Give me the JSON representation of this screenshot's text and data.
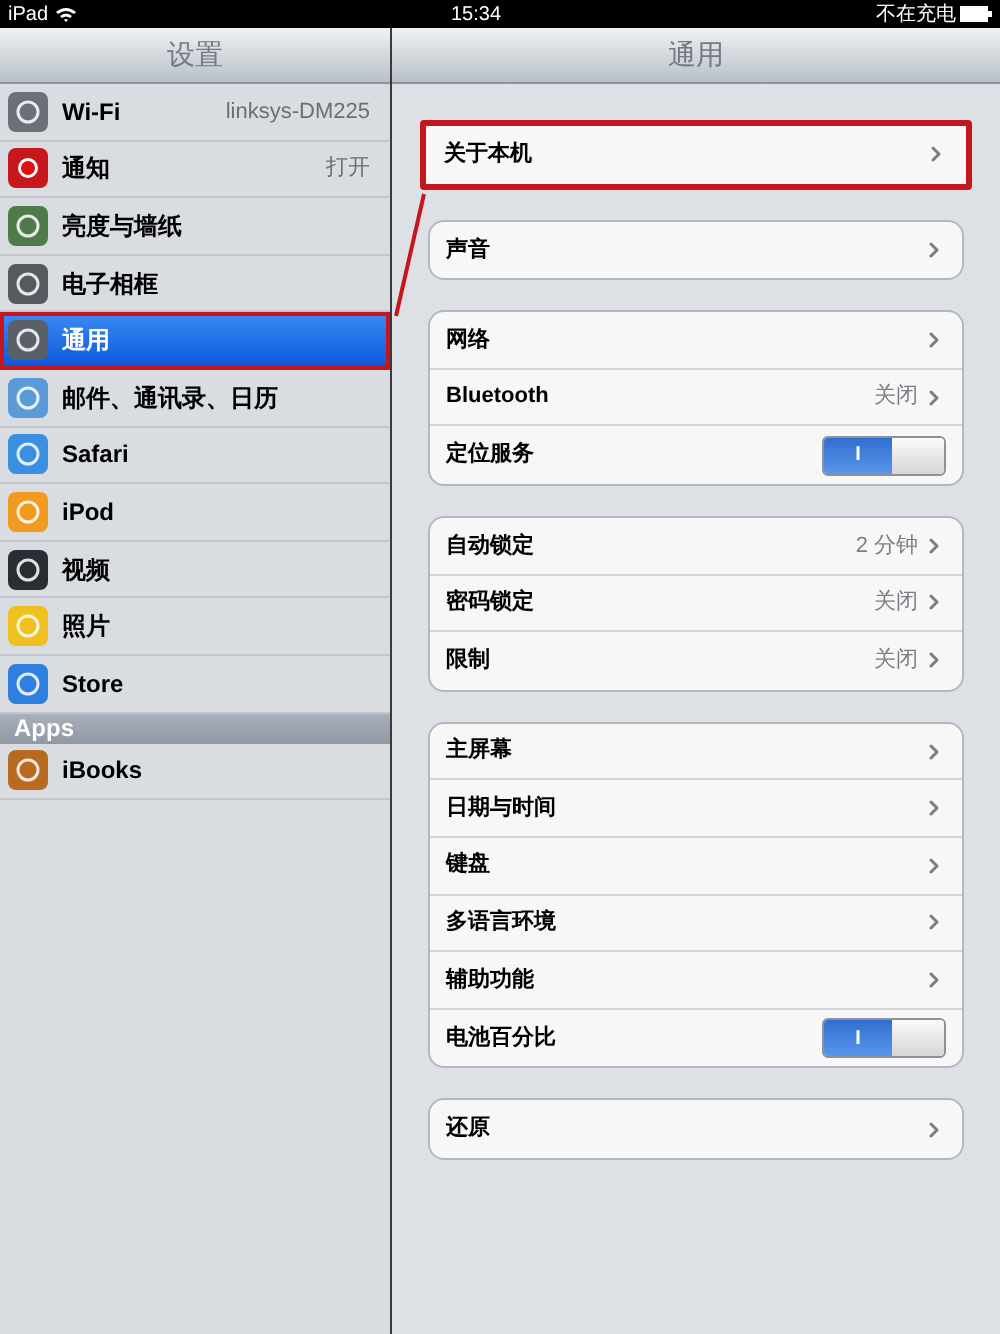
{
  "status_bar": {
    "device": "iPad",
    "time": "15:34",
    "charging": "不在充电"
  },
  "sidebar": {
    "title": "设置",
    "items": [
      {
        "label": "Wi-Fi",
        "value": "linksys-DM225",
        "selected": false,
        "highlighted": false
      },
      {
        "label": "通知",
        "value": "打开",
        "selected": false,
        "highlighted": false
      },
      {
        "label": "亮度与墙纸",
        "selected": false,
        "highlighted": false
      },
      {
        "label": "电子相框",
        "selected": false,
        "highlighted": false
      },
      {
        "label": "通用",
        "selected": true,
        "highlighted": true
      },
      {
        "label": "邮件、通讯录、日历",
        "selected": false,
        "highlighted": false
      },
      {
        "label": "Safari",
        "selected": false,
        "highlighted": false
      },
      {
        "label": "iPod",
        "selected": false,
        "highlighted": false
      },
      {
        "label": "视频",
        "selected": false,
        "highlighted": false
      },
      {
        "label": "照片",
        "selected": false,
        "highlighted": false
      },
      {
        "label": "Store",
        "selected": false,
        "highlighted": false
      }
    ],
    "section": {
      "title": "Apps",
      "items": [
        {
          "label": "iBooks",
          "selected": false,
          "highlighted": false
        }
      ]
    }
  },
  "detail": {
    "title": "通用",
    "groups": [
      {
        "highlighted": true,
        "rows": [
          {
            "kind": "link",
            "label": "关于本机"
          }
        ]
      },
      {
        "highlighted": false,
        "rows": [
          {
            "kind": "link",
            "label": "声音"
          }
        ]
      },
      {
        "highlighted": false,
        "rows": [
          {
            "kind": "link",
            "label": "网络"
          },
          {
            "kind": "link",
            "label": "Bluetooth",
            "value": "关闭"
          },
          {
            "kind": "switch",
            "label": "定位服务",
            "on": true,
            "switch_text": "I"
          }
        ]
      },
      {
        "highlighted": false,
        "rows": [
          {
            "kind": "link",
            "label": "自动锁定",
            "value": "2 分钟"
          },
          {
            "kind": "link",
            "label": "密码锁定",
            "value": "关闭"
          },
          {
            "kind": "link",
            "label": "限制",
            "value": "关闭"
          }
        ]
      },
      {
        "highlighted": false,
        "rows": [
          {
            "kind": "link",
            "label": "主屏幕"
          },
          {
            "kind": "link",
            "label": "日期与时间"
          },
          {
            "kind": "link",
            "label": "键盘"
          },
          {
            "kind": "link",
            "label": "多语言环境"
          },
          {
            "kind": "link",
            "label": "辅助功能"
          },
          {
            "kind": "switch",
            "label": "电池百分比",
            "on": true,
            "switch_text": "I"
          }
        ]
      },
      {
        "highlighted": false,
        "rows": [
          {
            "kind": "link",
            "label": "还原"
          }
        ]
      }
    ]
  }
}
